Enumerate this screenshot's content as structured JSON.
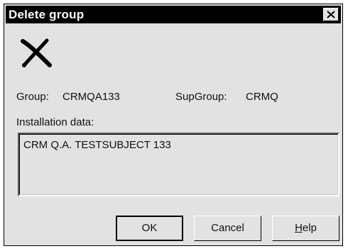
{
  "window": {
    "title": "Delete group"
  },
  "icons": {
    "close": "close-icon",
    "delete": "delete-x-icon"
  },
  "group": {
    "label": "Group:",
    "value": "CRMQA133"
  },
  "supgroup": {
    "label": "SupGroup:",
    "value": "CRMQ"
  },
  "installation": {
    "label": "Installation data:",
    "value": "CRM Q.A. TESTSUBJECT 133"
  },
  "buttons": {
    "ok": "OK",
    "cancel": "Cancel",
    "help_mnemonic": "H",
    "help_rest": "elp"
  },
  "colors": {
    "dialog_bg": "#e2e2e2",
    "titlebar_bg": "#000000",
    "title_text": "#ffffff"
  }
}
